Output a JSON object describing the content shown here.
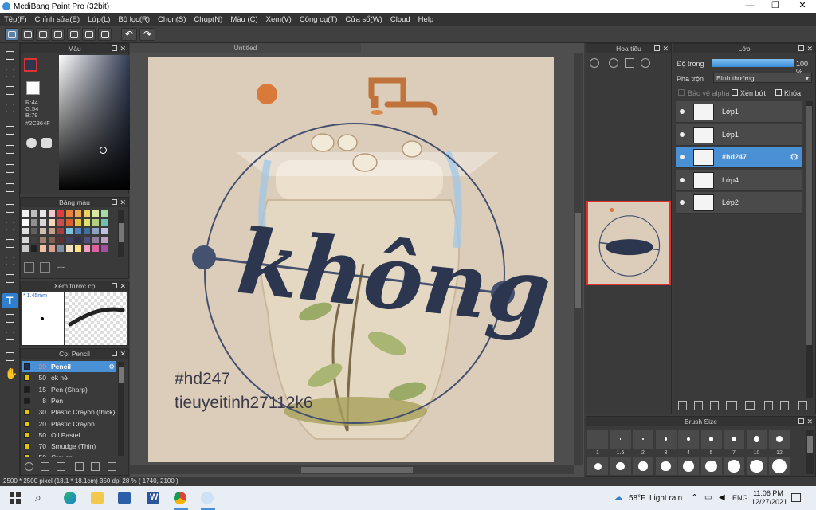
{
  "app": {
    "title": "MediBang Paint Pro (32bit)"
  },
  "menu": [
    "Tệp(F)",
    "Chỉnh sửa(E)",
    "Lớp(L)",
    "Bộ lọc(R)",
    "Chọn(S)",
    "Chụp(N)",
    "Màu (C)",
    "Xem(V)",
    "Công cụ(T)",
    "Cửa sổ(W)",
    "Cloud",
    "Help"
  ],
  "panels": {
    "color": {
      "title": "Màu",
      "r": "R:44",
      "g": "G:54",
      "b": "B:79",
      "hex": "#2C364F",
      "primary": "#2c364f",
      "secondary": "#ffffff"
    },
    "palette": {
      "title": "Bảng màu",
      "dash": "---"
    },
    "preview": {
      "title": "Xem trước cọ",
      "size": "* 1.45mm"
    },
    "brush": {
      "title": "Cọ: Pencil",
      "items": [
        {
          "size": "20",
          "name": "Pencil",
          "color": "#1a2f5a",
          "selected": true
        },
        {
          "size": "50",
          "name": "ok nè",
          "color": "#e0c800"
        },
        {
          "size": "15",
          "name": "Pen (Sharp)",
          "color": "#1c1c1c"
        },
        {
          "size": "8",
          "name": "Pen",
          "color": "#1c1c1c"
        },
        {
          "size": "30",
          "name": "Plastic Crayon (thick)",
          "color": "#e0c800"
        },
        {
          "size": "20",
          "name": "Plastic Crayon",
          "color": "#e0c800"
        },
        {
          "size": "50",
          "name": "Oil Pastel",
          "color": "#e0c800"
        },
        {
          "size": "70",
          "name": "Smudge (Thin)",
          "color": "#e0c800"
        },
        {
          "size": "50",
          "name": "Crayon",
          "color": "#e0c800"
        }
      ]
    },
    "navigator": {
      "title": "Hoa tiêu"
    },
    "layers": {
      "title": "Lớp",
      "opacity_label": "Độ trong",
      "opacity_value": "100 %",
      "opacity": 1.0,
      "blend_label": "Pha trộn",
      "blend_value": "Bình thường",
      "alpha_protect": "Bảo vệ alpha",
      "clip": "Xén bớt",
      "lock": "Khóa",
      "items": [
        {
          "name": "Lớp1",
          "selected": false
        },
        {
          "name": "Lớp1",
          "selected": false
        },
        {
          "name": "#hd247",
          "selected": true
        },
        {
          "name": "Lớp4",
          "selected": false
        },
        {
          "name": "Lớp2",
          "selected": false
        }
      ]
    },
    "brushsize": {
      "title": "Brush Size",
      "labels": [
        "1",
        "1.5",
        "2",
        "3",
        "4",
        "5",
        "7",
        "10",
        "12"
      ]
    }
  },
  "canvas": {
    "tab": "Untitled",
    "word": "không",
    "tag": "#hd247",
    "credit": "tieuyeitinh27112k6"
  },
  "status": "2500 * 2500 pixel  (18.1 * 18.1cm)  350 dpi   28 %  ( 1740, 2100 )",
  "taskbar": {
    "weather_temp": "58°F",
    "weather_text": "Light rain",
    "lang": "ENG",
    "time": "11:06 PM",
    "date": "12/27/2021"
  }
}
